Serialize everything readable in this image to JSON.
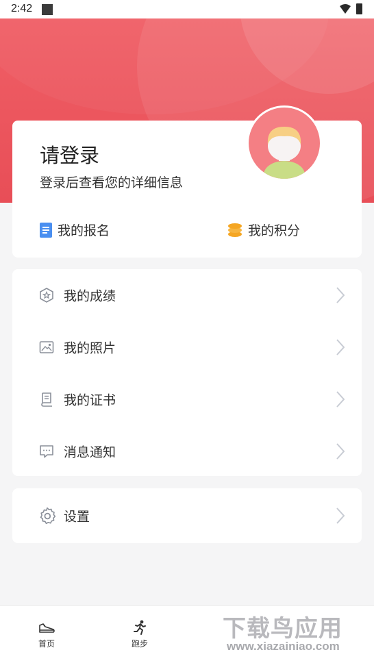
{
  "status_bar": {
    "time": "2:42"
  },
  "profile": {
    "title": "请登录",
    "subtitle": "登录后查看您的详细信息",
    "quick_links": [
      {
        "label": "我的报名",
        "icon": "document-icon",
        "color": "#4a8ff0"
      },
      {
        "label": "我的积分",
        "icon": "coins-icon",
        "color": "#f5a623"
      }
    ]
  },
  "menu": {
    "items": [
      {
        "label": "我的成绩",
        "icon": "badge-star-icon"
      },
      {
        "label": "我的照片",
        "icon": "photo-icon"
      },
      {
        "label": "我的证书",
        "icon": "certificate-icon"
      },
      {
        "label": "消息通知",
        "icon": "message-icon"
      }
    ]
  },
  "settings": {
    "label": "设置",
    "icon": "gear-icon"
  },
  "tabbar": {
    "tabs": [
      {
        "label": "首页",
        "icon": "sneaker-icon"
      },
      {
        "label": "跑步",
        "icon": "runner-icon"
      }
    ]
  },
  "watermark": {
    "logo": "下载鸟应用",
    "url": "www.xiazainiao.com"
  },
  "colors": {
    "brand": "#ec545c",
    "chevron": "#c8ccd4",
    "icon_gray": "#8a8f99"
  }
}
